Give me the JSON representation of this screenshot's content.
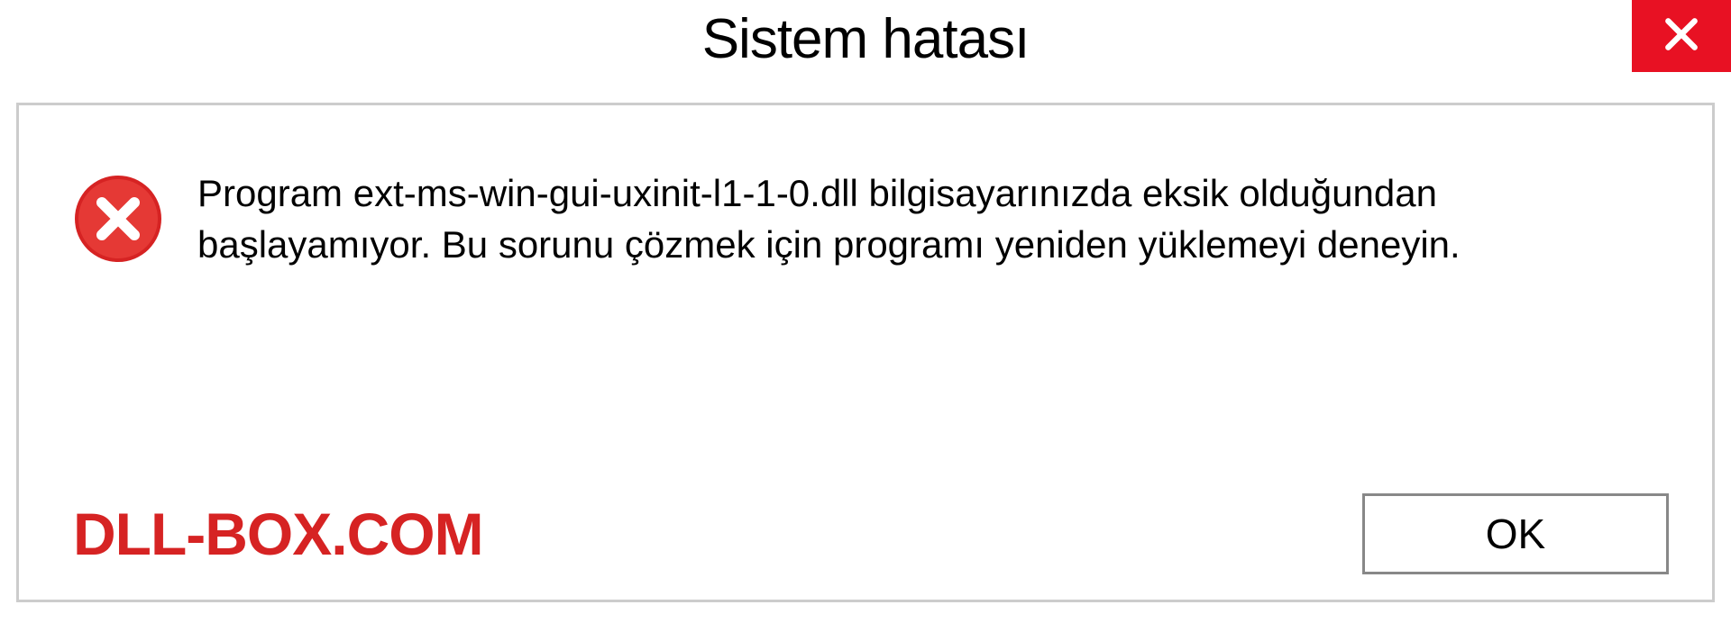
{
  "dialog": {
    "title": "Sistem hatası",
    "message": "Program ext-ms-win-gui-uxinit-l1-1-0.dll bilgisayarınızda eksik olduğundan başlayamıyor. Bu sorunu çözmek için programı yeniden yüklemeyi deneyin.",
    "ok_label": "OK"
  },
  "watermark": "DLL-BOX.COM"
}
